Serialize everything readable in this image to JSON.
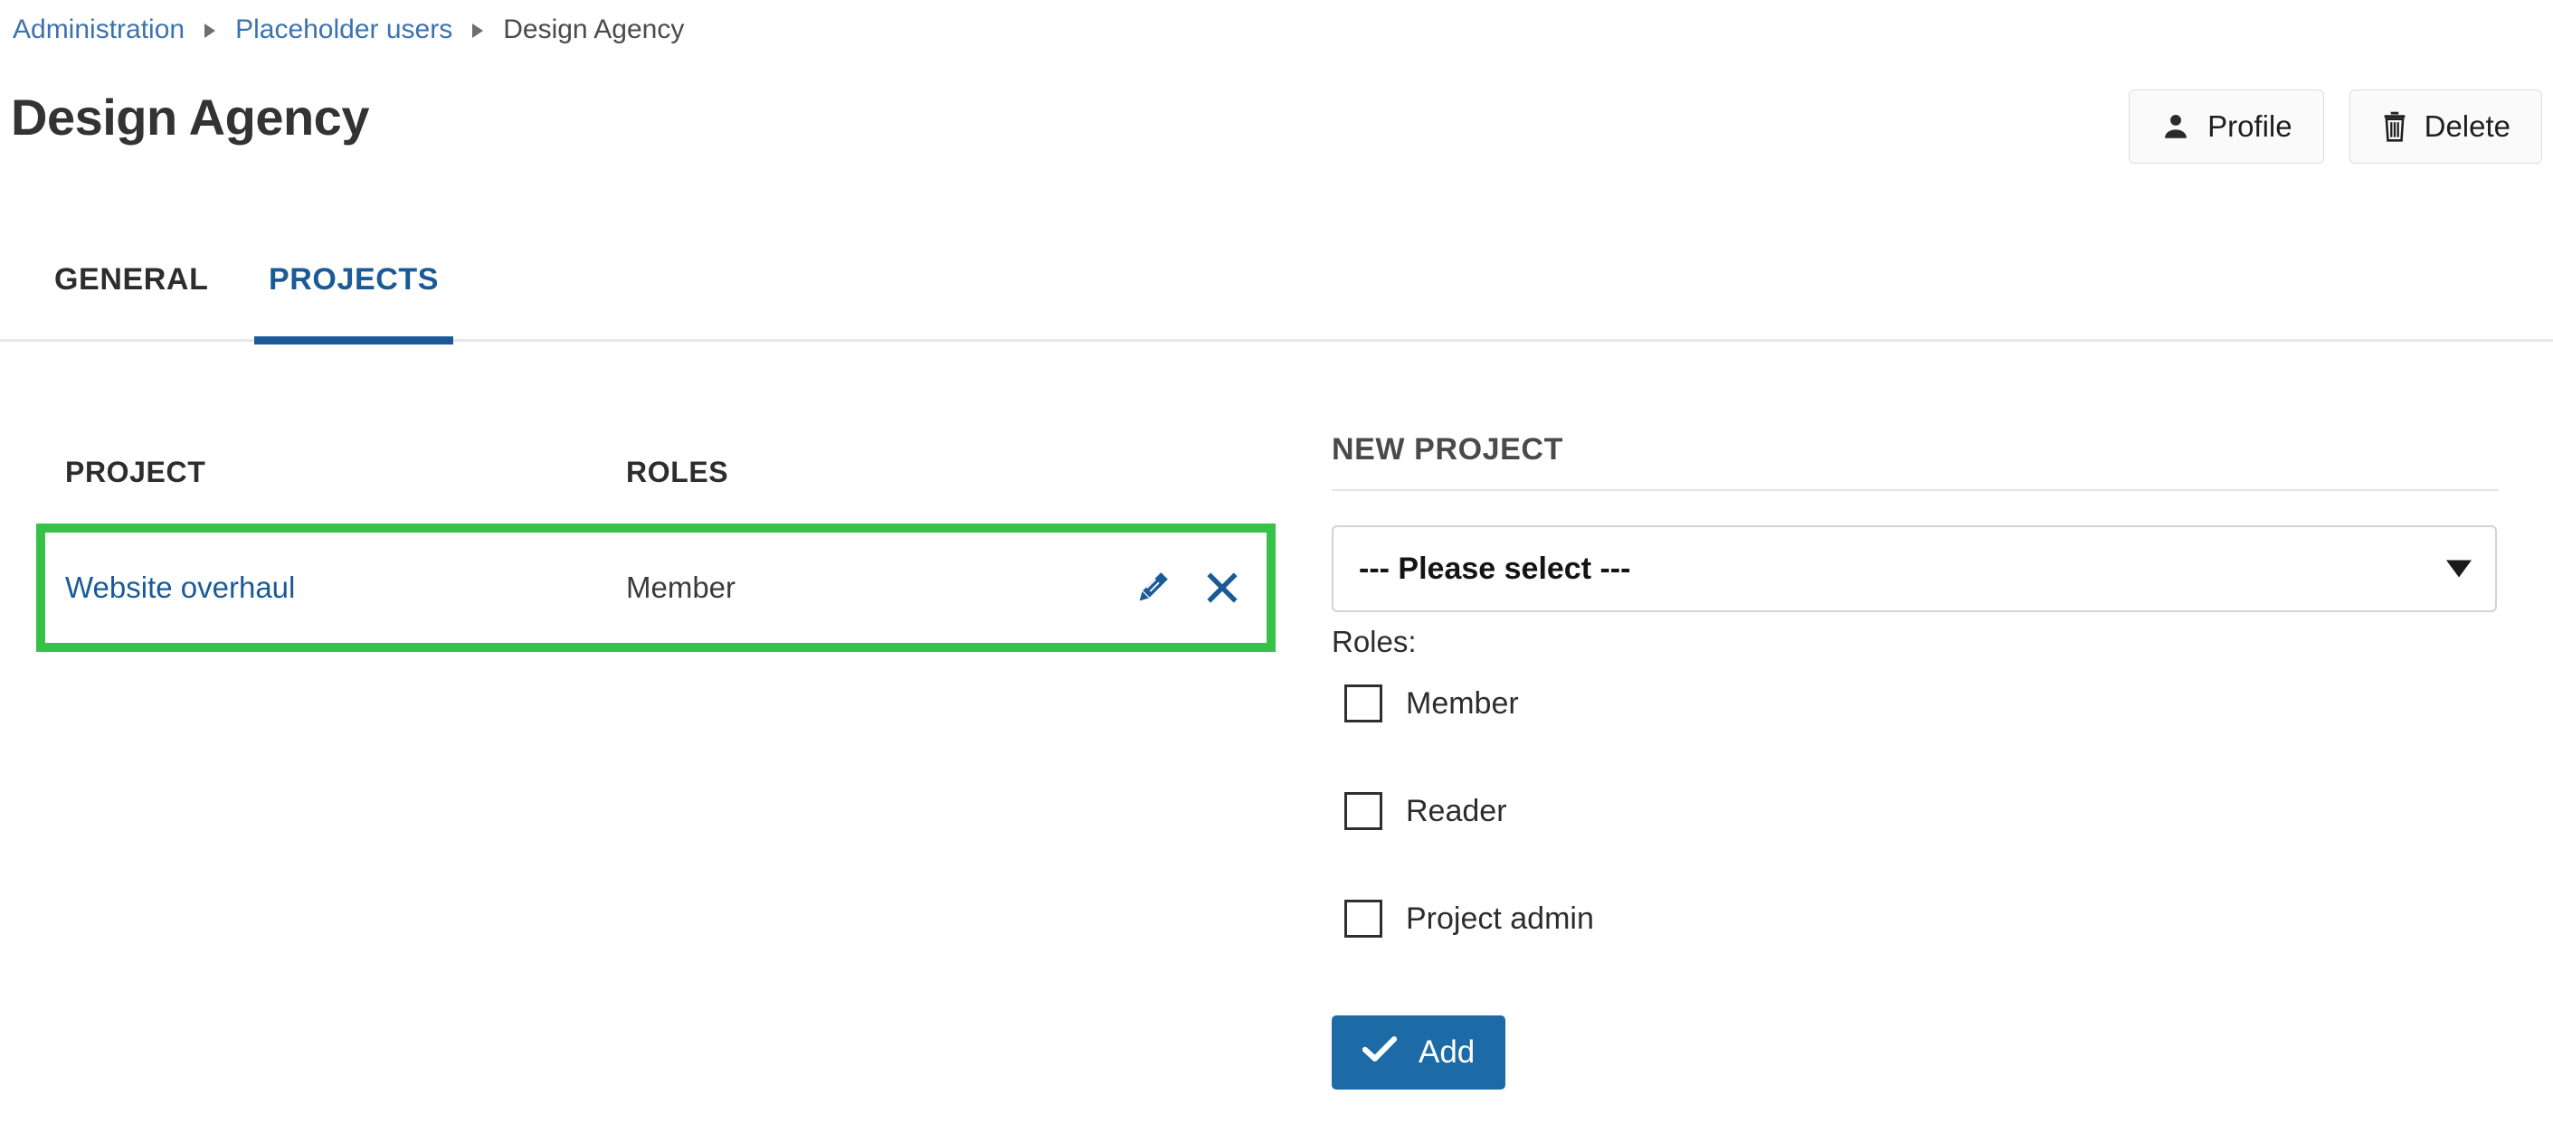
{
  "breadcrumb": {
    "items": [
      {
        "label": "Administration",
        "link": true
      },
      {
        "label": "Placeholder users",
        "link": true
      },
      {
        "label": "Design Agency",
        "link": false
      }
    ]
  },
  "header": {
    "title": "Design Agency",
    "actions": [
      {
        "label": "Profile",
        "icon": "user-icon"
      },
      {
        "label": "Delete",
        "icon": "trash-icon"
      }
    ]
  },
  "tabs": [
    {
      "label": "GENERAL",
      "active": false
    },
    {
      "label": "PROJECTS",
      "active": true
    }
  ],
  "projects_table": {
    "headers": [
      "PROJECT",
      "ROLES"
    ],
    "rows": [
      {
        "project": "Website overhaul",
        "roles": "Member",
        "highlighted": true,
        "edit_icon": "pencil-icon",
        "remove_icon": "close-x-icon"
      }
    ]
  },
  "new_project": {
    "title": "NEW PROJECT",
    "select": {
      "value": "--- Please select ---",
      "caret_icon": "chevron-down-icon"
    },
    "roles_label": "Roles:",
    "roles": [
      {
        "label": "Member",
        "checked": false
      },
      {
        "label": "Reader",
        "checked": false
      },
      {
        "label": "Project admin",
        "checked": false
      }
    ],
    "add_button": {
      "label": "Add",
      "icon": "check-icon"
    }
  },
  "colors": {
    "link": "#1a5a96",
    "breadcrumb_link": "#3b73af",
    "accent": "#1d6ba6",
    "highlight": "#36c247",
    "text": "#333333"
  }
}
